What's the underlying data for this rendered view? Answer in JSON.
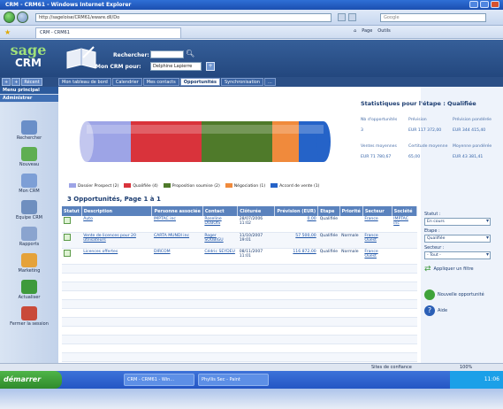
{
  "window": {
    "title": "CRM - CRM61 - Windows Internet Explorer"
  },
  "browser": {
    "url": "http://sageloise/CRM61/eware.dll/Do",
    "search_placeholder": "Google",
    "tab_label": "CRM - CRM61",
    "page_menu": "Page",
    "tools_menu": "Outils"
  },
  "crm": {
    "logo_top": "sage",
    "logo_bottom": "CRM",
    "search_label": "Rechercher:",
    "for_label": "Mon CRM pour:",
    "user": "Delphine Lapierre",
    "recent_label": "Récent",
    "main_menu": "Menu principal",
    "admin_menu": "Administrer"
  },
  "nav_tabs": [
    "Mon tableau de bord",
    "Calendrier",
    "Mes contacts",
    "Opportunités",
    "Synchronisation",
    "..."
  ],
  "active_tab": 3,
  "sidebar_items": [
    {
      "label": "Rechercher",
      "color": "#6a8fc8"
    },
    {
      "label": "Nouveau",
      "color": "#5fae52"
    },
    {
      "label": "Mon CRM",
      "color": "#7d9fd6"
    },
    {
      "label": "Equipe CRM",
      "color": "#6f8fbf"
    },
    {
      "label": "Rapports",
      "color": "#8aa4cf"
    },
    {
      "label": "Marketing",
      "color": "#e5a23a"
    },
    {
      "label": "Actualiser",
      "color": "#3e9a3c"
    },
    {
      "label": "Fermer la session",
      "color": "#c94a3a"
    }
  ],
  "stats": {
    "title": "Statistiques pour l'étape : Qualifiée",
    "labels": [
      "Nb d'opportunités",
      "Prévision",
      "Prévision pondérée",
      "Ventes moyennes",
      "Certitude moyenne",
      "Moyenne pondérée"
    ],
    "values": [
      "3",
      "EUR 117 372,00",
      "EUR 344 415,40",
      "EUR 71 780,67",
      "65,00",
      "EUR 43 381,41"
    ]
  },
  "legend": [
    {
      "label": "Dossier Prospect (2)",
      "color": "#9da4e6"
    },
    {
      "label": "Qualifiée (4)",
      "color": "#d9333b"
    },
    {
      "label": "Proposition soumise (2)",
      "color": "#4f7a2a"
    },
    {
      "label": "Négociation (1)",
      "color": "#f08a3c"
    },
    {
      "label": "Accord de vente (1)",
      "color": "#2563c8"
    }
  ],
  "grid": {
    "title": "3 Opportunités, Page 1 à 1",
    "columns": [
      "Statut",
      "Description",
      "Personne associée",
      "Contact",
      "Clôturée",
      "Prévision (EUR)",
      "Etape",
      "Priorité",
      "Secteur",
      "Société"
    ],
    "rows": [
      {
        "description": "Auto",
        "person": "IMPTAC inc",
        "contact": "Roseline DUBOIS",
        "date": "28/07/2006 11:02",
        "forecast": "0,00",
        "stage": "Qualifiée",
        "priority": "",
        "sector": "France",
        "company": "IMPTAC inc"
      },
      {
        "description": "Vente de licences pour 20 utilisateurs",
        "person": "CARTA MUNDI inc",
        "contact": "Roger SOUBIGU",
        "date": "11/10/2007 19:01",
        "forecast": "57 500,00",
        "stage": "Qualifiée",
        "priority": "Normale",
        "sector": "France Ouest",
        "company": ""
      },
      {
        "description": "Licences offertes",
        "person": "DIRCOM",
        "contact": "Cédric SEYDEU",
        "date": "08/11/2007 11:01",
        "forecast": "116 872,00",
        "stage": "Qualifiée",
        "priority": "Normale",
        "sector": "France Ouest",
        "company": ""
      }
    ]
  },
  "filters": {
    "status_label": "Statut :",
    "status_value": "En cours",
    "stage_label": "Etape :",
    "stage_value": "Qualifiée",
    "sector_label": "Secteur :",
    "sector_value": "- Tout -",
    "apply_label": "Appliquer un filtre",
    "new_label": "Nouvelle opportunité",
    "help_label": "Aide"
  },
  "statusbar": {
    "zone": "Sites de confiance",
    "zoom": "100%"
  },
  "taskbar": {
    "start": "démarrer",
    "tasks": [
      "CRM - CRM61 - Win...",
      "Phyllis Sec - Paint"
    ],
    "clock": "11:06"
  }
}
